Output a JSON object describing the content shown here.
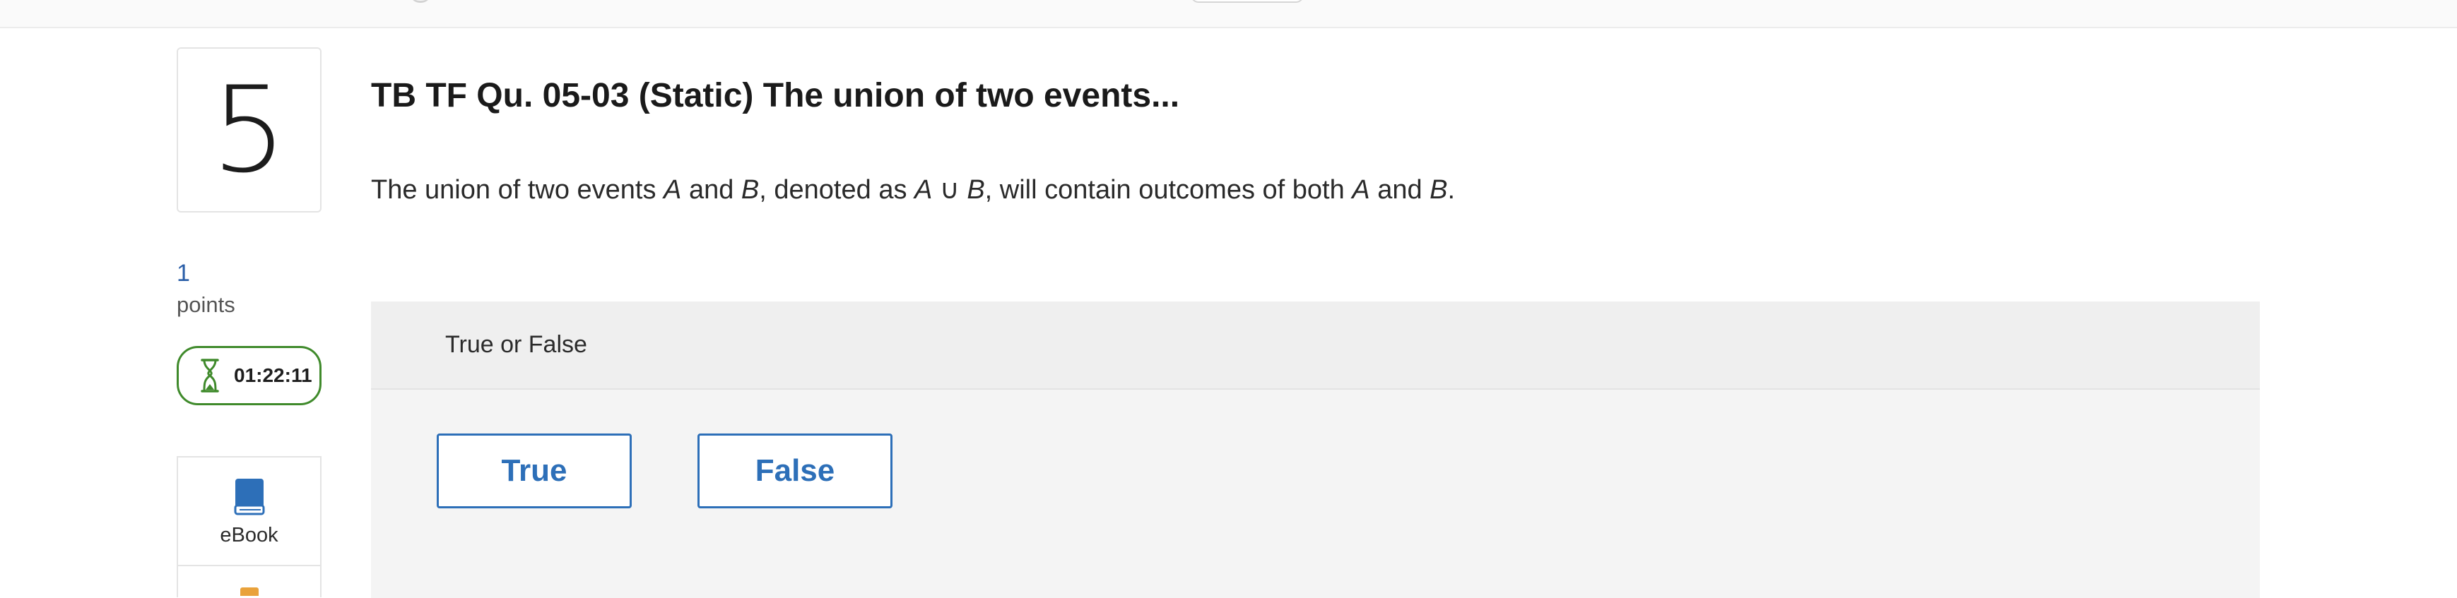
{
  "question": {
    "number": "5",
    "points_value": "1",
    "points_label": "points",
    "title": "TB TF Qu. 05-03 (Static) The union of two events...",
    "text": {
      "part1": "The union of two events ",
      "var_a1": "A",
      "part2": " and ",
      "var_b1": "B",
      "part3": ", denoted as ",
      "var_a2": "A",
      "union_symbol": " ∪ ",
      "var_b2": "B",
      "part4": ", will contain outcomes of both ",
      "var_a3": "A",
      "part5": " and ",
      "var_b3": "B",
      "part6": "."
    }
  },
  "timer": {
    "time": "01:22:11",
    "icon": "hourglass-icon"
  },
  "tools": {
    "ebook_label": "eBook",
    "ebook_icon": "book-icon"
  },
  "answer_panel": {
    "header": "True or False",
    "options": {
      "true_label": "True",
      "false_label": "False"
    }
  },
  "colors": {
    "accent_blue": "#2d6fb8",
    "timer_green": "#3f8a2b",
    "points_blue": "#2a5ea8",
    "panel_gray": "#f4f4f4"
  }
}
